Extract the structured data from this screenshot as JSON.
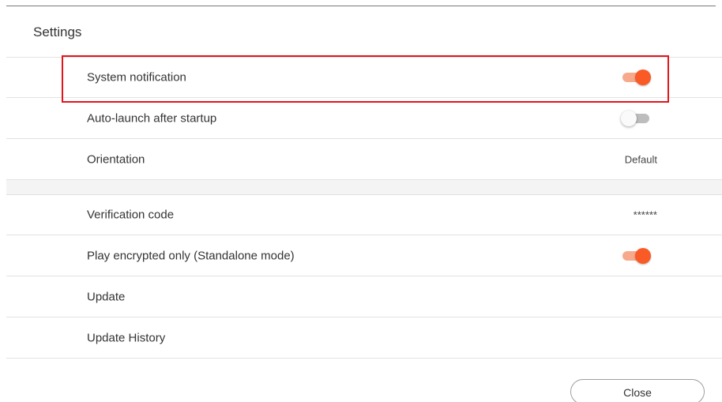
{
  "header": {
    "title": "Settings"
  },
  "settings": {
    "system_notification": {
      "label": "System notification",
      "enabled": true
    },
    "auto_launch": {
      "label": "Auto-launch after startup",
      "enabled": false
    },
    "orientation": {
      "label": "Orientation",
      "value": "Default"
    },
    "verification_code": {
      "label": "Verification code",
      "value": "******"
    },
    "play_encrypted": {
      "label": "Play encrypted only (Standalone mode)",
      "enabled": true
    },
    "update": {
      "label": "Update"
    },
    "update_history": {
      "label": "Update History"
    }
  },
  "footer": {
    "close_label": "Close"
  },
  "colors": {
    "accent": "#fa5a25",
    "accent_track": "#f7a98b",
    "highlight": "#e3141b"
  }
}
